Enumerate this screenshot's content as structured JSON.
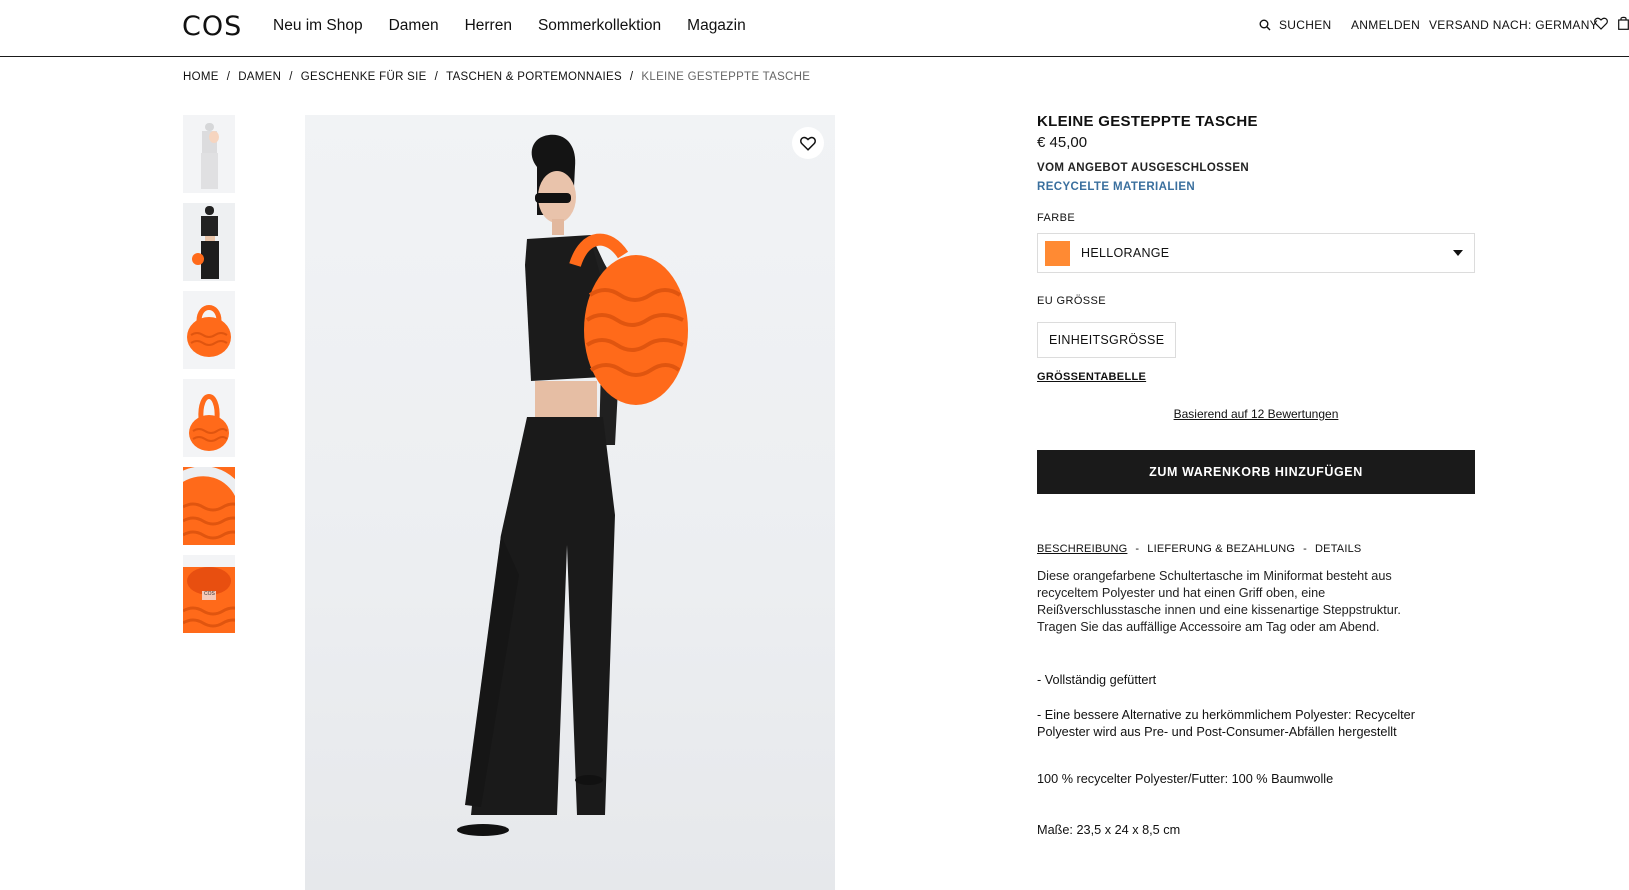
{
  "header": {
    "logo": "COS",
    "nav": [
      "Neu im Shop",
      "Damen",
      "Herren",
      "Sommerkollektion",
      "Magazin"
    ],
    "search_label": "SUCHEN",
    "login_label": "ANMELDEN",
    "shipping_label": "VERSAND NACH: GERMANY"
  },
  "breadcrumb": [
    "HOME",
    "DAMEN",
    "GESCHENKE FÜR SIE",
    "TASCHEN & PORTEMONNAIES",
    "KLEINE GESTEPPTE TASCHE"
  ],
  "product": {
    "title": "KLEINE GESTEPPTE TASCHE",
    "price": "€ 45,00",
    "excluded": "VOM ANGEBOT AUSGESCHLOSSEN",
    "recycled": "RECYCELTE MATERIALIEN",
    "color_label": "FARBE",
    "color_name": "HELLORANGE",
    "color_hex": "#ff8a33",
    "size_label": "EU GRÖSSE",
    "size_value": "EINHEITSGRÖSSE",
    "size_chart": "GRÖSSENTABELLE",
    "reviews": "Basierend auf 12 Bewertungen",
    "cart_button": "ZUM WARENKORB HINZUFÜGEN"
  },
  "tabs": [
    "BESCHREIBUNG",
    "LIEFERUNG & BEZAHLUNG",
    "DETAILS"
  ],
  "description": {
    "lines": [
      "Diese orangefarbene Schultertasche im Miniformat besteht aus",
      "recyceltem Polyester und hat einen Griff oben, eine",
      "Reißverschlusstasche innen und eine kissenartige Steppstruktur.",
      "Tragen Sie das auffällige Accessoire am Tag oder am Abend."
    ],
    "bullet1": "- Vollständig gefüttert",
    "bullet2_line1": "- Eine bessere Alternative zu herkömmlichem Polyester: Recycelter",
    "bullet2_line2": "Polyester wird aus Pre- und Post-Consumer-Abfällen hergestellt",
    "material": "100 % recycelter Polyester/Futter: 100 % Baumwolle",
    "measure": "Maße: 23,5 x 24 x 8,5 cm"
  },
  "colors": {
    "accent_orange": "#ff6a1a",
    "button_dark": "#1a1a1a",
    "link_blue": "#3a6f9e"
  },
  "thumbnail_logo": "COS"
}
